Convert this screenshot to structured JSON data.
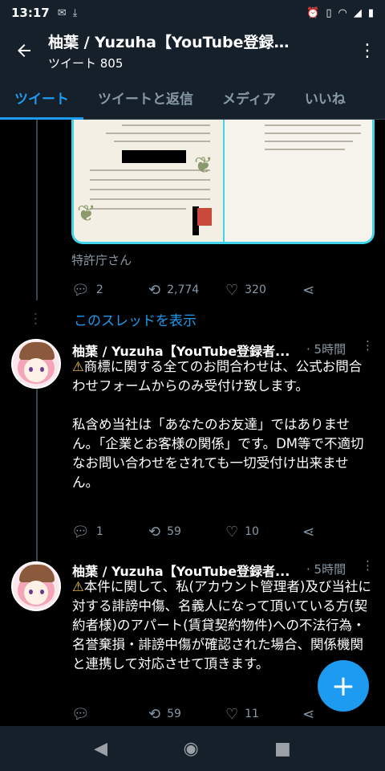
{
  "status_bar": {
    "time": "13:17",
    "left_icons": [
      "mail-icon",
      "download-icon"
    ],
    "right_icons": [
      "alarm-icon",
      "vibrate-icon",
      "wifi-icon",
      "signal-icon",
      "battery-icon"
    ]
  },
  "header": {
    "title": "柚葉 / Yuzuha【YouTube登録…",
    "subtitle": "ツイート 805"
  },
  "tabs": [
    {
      "label": "ツイート",
      "active": true
    },
    {
      "label": "ツイートと返信",
      "active": false
    },
    {
      "label": "メディア",
      "active": false
    },
    {
      "label": "いいね",
      "active": false
    }
  ],
  "prev_tweet": {
    "source": "特許庁さん",
    "reply_count": "2",
    "retweet_count": "2,774",
    "like_count": "320"
  },
  "show_thread": "このスレッドを表示",
  "tweets": [
    {
      "name": "柚葉 / Yuzuha【YouTube登録者...",
      "time": "· 5時間",
      "body": "商標に関する全てのお問合わせは、公式お問合わせフォームからのみ受付け致します。\n\n私含め当社は「あなたのお友達」ではありません。「企業とお客様の関係」です。DM等で不適切なお問い合わせをされても一切受付け出来ません。",
      "reply_count": "1",
      "retweet_count": "59",
      "like_count": "10"
    },
    {
      "name": "柚葉 / Yuzuha【YouTube登録者...",
      "time": "· 5時間",
      "body": "本件に関して、私(アカウント管理者)及び当社に対する誹謗中傷、名義人になって頂いている方(契約者様)のアパート(賃貸契約物件)への不法行為・名誉棄損・誹謗中傷が確認された場合、関係機関と連携して対応させて頂きます。",
      "reply_count": "",
      "retweet_count": "59",
      "like_count": "11"
    }
  ],
  "colors": {
    "accent": "#1d9bf0",
    "background": "#000000",
    "header_bg": "#15202b",
    "muted": "#8899a6",
    "media_border": "#3fd4e8"
  }
}
